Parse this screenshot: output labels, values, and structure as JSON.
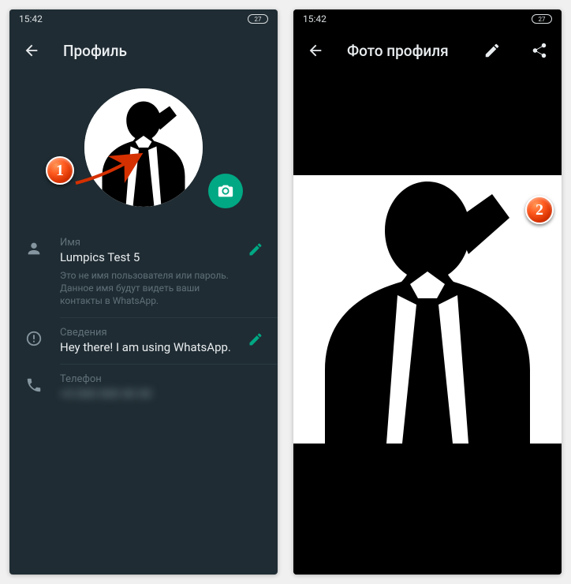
{
  "statusbar": {
    "time": "15:42",
    "battery": "27"
  },
  "left": {
    "toolbar": {
      "title": "Профиль"
    },
    "name": {
      "label": "Имя",
      "value": "Lumpics Test 5",
      "hint": "Это не имя пользователя или пароль. Данное имя будут видеть ваши контакты в WhatsApp."
    },
    "about": {
      "label": "Сведения",
      "value": "Hey there! I am using WhatsApp."
    },
    "phone": {
      "label": "Телефон",
      "value": "+0 000 000 00 00"
    }
  },
  "right": {
    "toolbar": {
      "title": "Фото профиля"
    }
  },
  "badges": {
    "one": "1",
    "two": "2"
  }
}
